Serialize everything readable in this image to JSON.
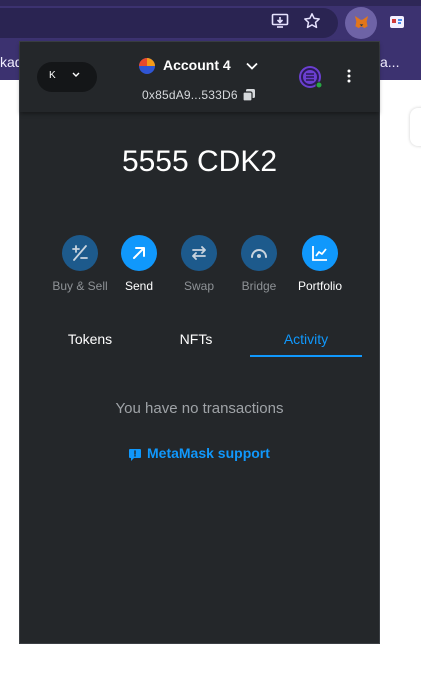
{
  "browser": {
    "bookmarks": [
      "kad",
      "a..."
    ]
  },
  "network": {
    "letter": "K"
  },
  "header": {
    "account_name": "Account 4",
    "address": "0x85dA9...533D6"
  },
  "balance": "5555 CDK2",
  "actions": [
    {
      "label": "Buy & Sell",
      "enabled": false,
      "icon": "plus-minus-icon"
    },
    {
      "label": "Send",
      "enabled": true,
      "icon": "arrow-up-right-icon"
    },
    {
      "label": "Swap",
      "enabled": false,
      "icon": "swap-arrows-icon"
    },
    {
      "label": "Bridge",
      "enabled": false,
      "icon": "bridge-icon"
    },
    {
      "label": "Portfolio",
      "enabled": true,
      "icon": "chart-icon"
    }
  ],
  "tabs": [
    {
      "label": "Tokens",
      "active": false
    },
    {
      "label": "NFTs",
      "active": false
    },
    {
      "label": "Activity",
      "active": true
    }
  ],
  "activity": {
    "empty_message": "You have no transactions",
    "support_link": "MetaMask support"
  },
  "colors": {
    "accent": "#1098fc",
    "popup_bg": "#24272a",
    "browser_bg": "#3c3270"
  }
}
